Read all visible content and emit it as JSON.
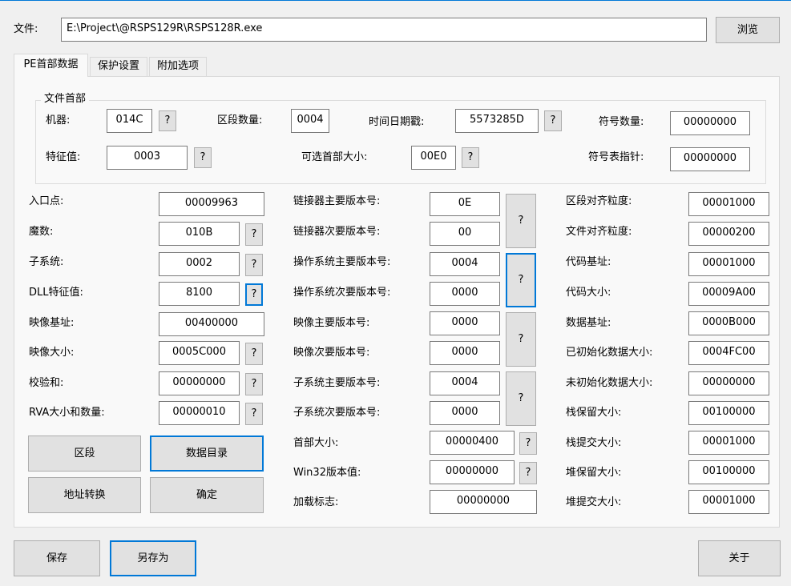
{
  "file": {
    "label": "文件:",
    "path": "E:\\Project\\@RSPS129R\\RSPS128R.exe",
    "browse": "浏览"
  },
  "tabs": [
    "PE首部数据",
    "保护设置",
    "附加选项"
  ],
  "header_group": {
    "title": "文件首部",
    "machine": {
      "label": "机器:",
      "value": "014C"
    },
    "sections": {
      "label": "区段数量:",
      "value": "0004"
    },
    "timestamp": {
      "label": "时间日期戳:",
      "value": "5573285D"
    },
    "symbols": {
      "label": "符号数量:",
      "value": "00000000"
    },
    "characteristics": {
      "label": "特征值:",
      "value": "0003"
    },
    "opt_header_size": {
      "label": "可选首部大小:",
      "value": "00E0"
    },
    "symtab_ptr": {
      "label": "符号表指针:",
      "value": "00000000"
    }
  },
  "left": [
    {
      "label": "入口点:",
      "value": "00009963"
    },
    {
      "label": "魔数:",
      "value": "010B"
    },
    {
      "label": "子系统:",
      "value": "0002"
    },
    {
      "label": "DLL特征值:",
      "value": "8100"
    },
    {
      "label": "映像基址:",
      "value": "00400000"
    },
    {
      "label": "映像大小:",
      "value": "0005C000"
    },
    {
      "label": "校验和:",
      "value": "00000000"
    },
    {
      "label": "RVA大小和数量:",
      "value": "00000010"
    }
  ],
  "middle": [
    {
      "label": "链接器主要版本号:",
      "value": "0E"
    },
    {
      "label": "链接器次要版本号:",
      "value": "00"
    },
    {
      "label": "操作系统主要版本号:",
      "value": "0004"
    },
    {
      "label": "操作系统次要版本号:",
      "value": "0000"
    },
    {
      "label": "映像主要版本号:",
      "value": "0000"
    },
    {
      "label": "映像次要版本号:",
      "value": "0000"
    },
    {
      "label": "子系统主要版本号:",
      "value": "0004"
    },
    {
      "label": "子系统次要版本号:",
      "value": "0000"
    },
    {
      "label": "首部大小:",
      "value": "00000400"
    },
    {
      "label": "Win32版本值:",
      "value": "00000000"
    },
    {
      "label": "加载标志:",
      "value": "00000000"
    }
  ],
  "right": [
    {
      "label": "区段对齐粒度:",
      "value": "00001000"
    },
    {
      "label": "文件对齐粒度:",
      "value": "00000200"
    },
    {
      "label": "代码基址:",
      "value": "00001000"
    },
    {
      "label": "代码大小:",
      "value": "00009A00"
    },
    {
      "label": "数据基址:",
      "value": "0000B000"
    },
    {
      "label": "已初始化数据大小:",
      "value": "0004FC00"
    },
    {
      "label": "未初始化数据大小:",
      "value": "00000000"
    },
    {
      "label": "栈保留大小:",
      "value": "00100000"
    },
    {
      "label": "栈提交大小:",
      "value": "00001000"
    },
    {
      "label": "堆保留大小:",
      "value": "00100000"
    },
    {
      "label": "堆提交大小:",
      "value": "00001000"
    }
  ],
  "q": "?",
  "buttons": {
    "sections": "区段",
    "data_directory": "数据目录",
    "address_convert": "地址转换",
    "ok": "确定",
    "save": "保存",
    "save_as": "另存为",
    "about": "关于"
  },
  "colors": {
    "background": "#f0f0f0",
    "panel": "#f9f9f9",
    "focus_border": "#0078d7",
    "button": "#e1e1e1"
  }
}
